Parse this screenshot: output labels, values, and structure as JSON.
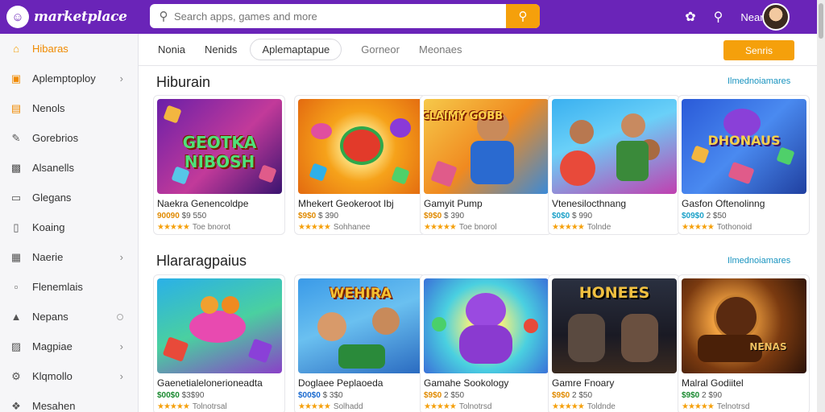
{
  "app": {
    "logo_text": "marketplace",
    "logo_glyph": "☺"
  },
  "search": {
    "placeholder": "Search apps, games and more",
    "icon": "search-icon",
    "button_icon": "search-icon"
  },
  "topbar": {
    "user_label": "Nearoo",
    "notification_count": "0"
  },
  "sidebar": {
    "items": [
      {
        "label": "Hibaras",
        "icon": "home-icon",
        "active": true,
        "chevron": false
      },
      {
        "label": "Aplemptoploy",
        "icon": "apps-icon",
        "active": false,
        "chevron": true
      },
      {
        "label": "Nenols",
        "icon": "bag-icon",
        "active": false,
        "chevron": false
      },
      {
        "label": "Gorebrios",
        "icon": "brush-icon",
        "active": false,
        "chevron": false
      },
      {
        "label": "Alsanells",
        "icon": "monitor-icon",
        "active": false,
        "chevron": false
      },
      {
        "label": "Glegans",
        "icon": "card-icon",
        "active": false,
        "chevron": false
      },
      {
        "label": "Koaing",
        "icon": "doc-icon",
        "active": false,
        "chevron": false
      },
      {
        "label": "Naerie",
        "icon": "grid-icon",
        "active": false,
        "chevron": true
      },
      {
        "label": "Flenemlais",
        "icon": "screen-icon",
        "active": false,
        "chevron": false
      },
      {
        "label": "Nepans",
        "icon": "person-icon",
        "active": false,
        "chevron": false,
        "dot": true
      },
      {
        "label": "Magpiae",
        "icon": "gift-icon",
        "active": false,
        "chevron": true
      },
      {
        "label": "Klqmollo",
        "icon": "gear-icon",
        "active": false,
        "chevron": true
      },
      {
        "label": "Mesahen",
        "icon": "puzzle-icon",
        "active": false,
        "chevron": false
      }
    ]
  },
  "tabs": [
    {
      "label": "Nonia",
      "active": false
    },
    {
      "label": "Nenids",
      "active": false
    },
    {
      "label": "Aplemaptapue",
      "active": true
    },
    {
      "label": "Gorneor",
      "active": false
    },
    {
      "label": "Meonaes",
      "active": false
    }
  ],
  "action_button": "Senris",
  "sections": [
    {
      "title": "Hiburain",
      "link": "Ilmednoiamares",
      "cards": [
        {
          "title": "Naekra Genencoldpe",
          "price": "90090",
          "price2": "$9 550",
          "reviews": "Toe bnorot",
          "thumb_text": "GEOTKA NIBOSH"
        },
        {
          "title": "Mhekert Geokeroot Ibj",
          "price": "$9$0",
          "price2": "$ 390",
          "reviews": "Sohhanee",
          "thumb_text": ""
        },
        {
          "title": "Gamyit Pump",
          "price": "$9$0",
          "price2": "$ 390",
          "reviews": "Toe bnorol",
          "thumb_text": "CLAIMY GOBB"
        },
        {
          "title": "Vtenesilocthnang",
          "price": "$0$0",
          "price2": "$ 990",
          "reviews": "Tolnde",
          "thumb_text": ""
        },
        {
          "title": "Gasfon Oftenolinng",
          "price": "$09$0",
          "price2": "2 $50",
          "reviews": "Tothonoid",
          "thumb_text": "DHONAUS"
        }
      ]
    },
    {
      "title": "Hlararagpaius",
      "link": "Ilmednoiamares",
      "cards": [
        {
          "title": "Gaenetialelonerioneadta",
          "price": "$00$0",
          "price2": "$3$90",
          "reviews": "Tolnotrsal",
          "thumb_text": ""
        },
        {
          "title": "Doglaee Peplaoeda",
          "price": "$00$0",
          "price2": "$ 3$0",
          "reviews": "Solhadd",
          "thumb_text": "WEHIRA"
        },
        {
          "title": "Gamahe Sookology",
          "price": "$9$0",
          "price2": "2 $50",
          "reviews": "Tolnotrsd",
          "thumb_text": ""
        },
        {
          "title": "Gamre Fnoary",
          "price": "$9$0",
          "price2": "2 $50",
          "reviews": "Toldnde",
          "thumb_text": "HONEES"
        },
        {
          "title": "Malral Godiitel",
          "price": "$9$0",
          "price2": "2 $90",
          "reviews": "Telnotrsd",
          "thumb_text": "NENAS"
        }
      ]
    }
  ],
  "star_glyphs": "★★★★★"
}
